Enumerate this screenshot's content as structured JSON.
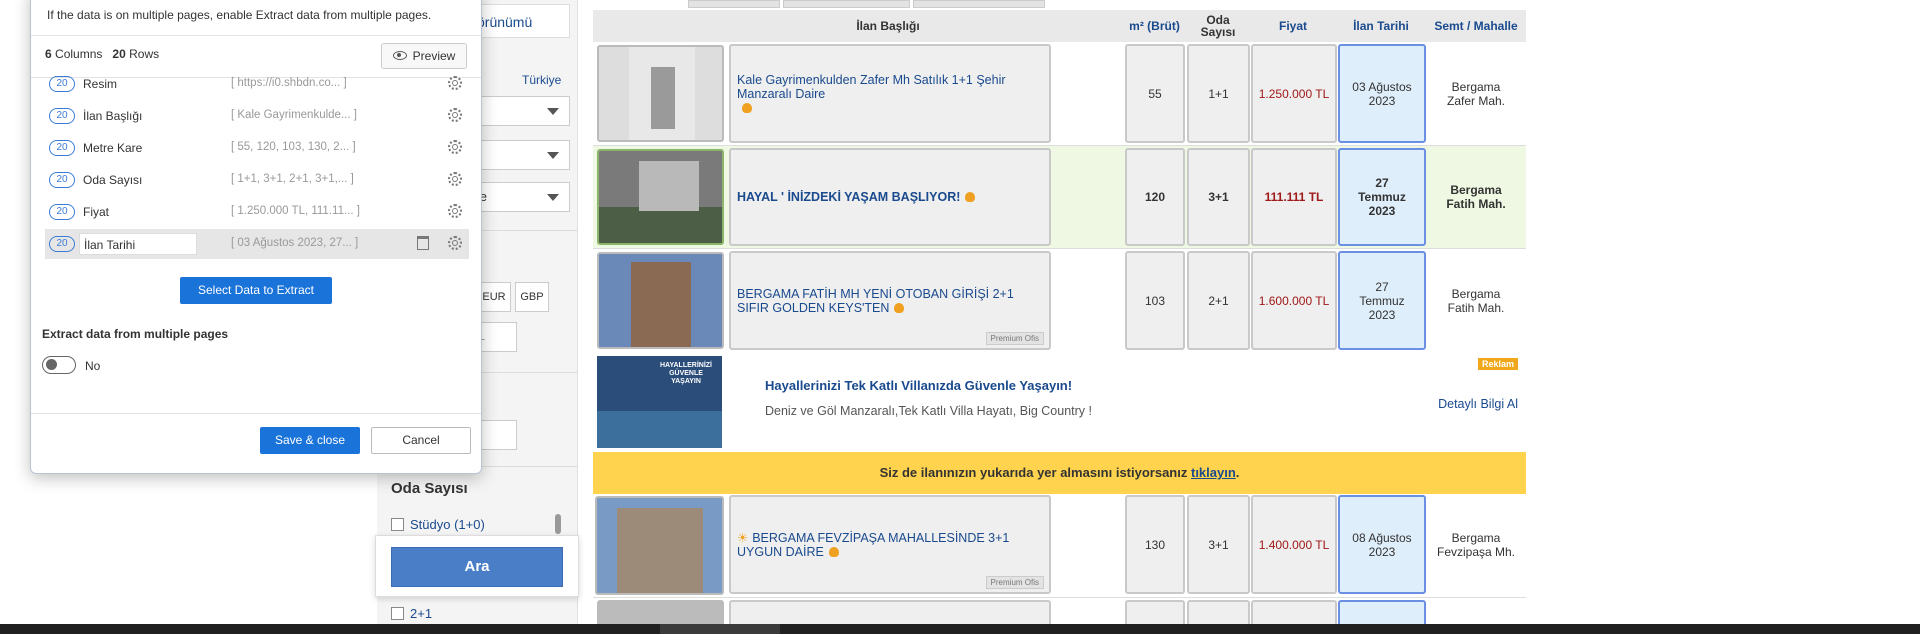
{
  "sidebar": {
    "tab_label": "örünümü",
    "country_label": "Türkiye",
    "select3_value": "lle",
    "currencies": [
      "EUR",
      "GBP"
    ],
    "tl_value": "TL",
    "oda_title": "Oda Sayısı",
    "oda_items": [
      "Stüdyo (1+0)",
      "2+1"
    ],
    "search_button": "Ara"
  },
  "table": {
    "headers": {
      "title": "İlan Başlığı",
      "m2": "m² (Brüt)",
      "rooms": "Oda Sayısı",
      "price": "Fiyat",
      "date": "İlan Tarihi",
      "location": "Semt / Mahalle"
    },
    "rows": [
      {
        "title": "Kale Gayrimenkulden Zafer Mh Satılık 1+1 Şehir Manzaralı Daire",
        "m2": "55",
        "rooms": "1+1",
        "price": "1.250.000 TL",
        "date": "03 Ağustos 2023",
        "loc1": "Bergama",
        "loc2": "Zafer Mah.",
        "premium": ""
      },
      {
        "title": "HAYAL ' İNİZDEKİ YAŞAM BAŞLIYOR!",
        "m2": "120",
        "rooms": "3+1",
        "price": "111.111 TL",
        "date": "27 Temmuz 2023",
        "loc1": "Bergama",
        "loc2": "Fatih Mah.",
        "premium": ""
      },
      {
        "title": "BERGAMA FATİH MH YENİ OTOBAN GİRİŞİ 2+1 SIFIR GOLDEN KEYS'TEN",
        "m2": "103",
        "rooms": "2+1",
        "price": "1.600.000 TL",
        "date": "27 Temmuz 2023",
        "loc1": "Bergama",
        "loc2": "Fatih Mah.",
        "premium": "Premium Ofis"
      },
      {
        "title": "BERGAMA FEVZİPAŞA MAHALLESİNDE 3+1 UYGUN DAİRE",
        "m2": "130",
        "rooms": "3+1",
        "price": "1.400.000 TL",
        "date": "08 Ağustos 2023",
        "loc1": "Bergama",
        "loc2": "Fevzipaşa Mh.",
        "premium": "Premium Ofis"
      }
    ],
    "ad": {
      "title": "Hayallerinizi Tek Katlı Villanızda Güvenle Yaşayın!",
      "subtitle": "Deniz ve Göl Manzaralı,Tek Katlı Villa Hayatı, Big Country !",
      "badge": "Reklam",
      "link": "Detaylı Bilgi Al",
      "image_text": "HAYALLERİNİZİ GÜVENLE YAŞAYIN"
    },
    "promo": {
      "text": "Siz de ilanınızın yukarıda yer almasını istiyorsanız",
      "link": "tıklayın",
      "end": "."
    }
  },
  "panel": {
    "info": "If the data is on multiple pages, enable Extract data from multiple pages.",
    "columns_count": "6",
    "columns_label": "Columns",
    "rows_count": "20",
    "rows_label": "Rows",
    "preview": "Preview",
    "columns": [
      {
        "count": "20",
        "name": "Resim",
        "sample": "[ https://i0.shbdn.co...  ]"
      },
      {
        "count": "20",
        "name": "İlan Başlığı",
        "sample": "[ Kale Gayrimenkulde...  ]"
      },
      {
        "count": "20",
        "name": "Metre Kare",
        "sample": "[ 55, 120, 103, 130, 2...  ]"
      },
      {
        "count": "20",
        "name": "Oda Sayısı",
        "sample": "[ 1+1, 3+1, 2+1, 3+1,...  ]"
      },
      {
        "count": "20",
        "name": "Fiyat",
        "sample": "[ 1.250.000 TL, 111.11...  ]"
      },
      {
        "count": "20",
        "name": "İlan Tarihi",
        "sample": "[ 03 Ağustos 2023, 27...  ]"
      }
    ],
    "select_button": "Select Data to Extract",
    "multi_label": "Extract data from multiple pages",
    "toggle_value": "No",
    "save_button": "Save & close",
    "cancel_button": "Cancel"
  },
  "colors": {
    "primary": "#1a73d9",
    "link": "#1a4a8e",
    "price": "#a01818",
    "promo": "#ffd34d"
  }
}
